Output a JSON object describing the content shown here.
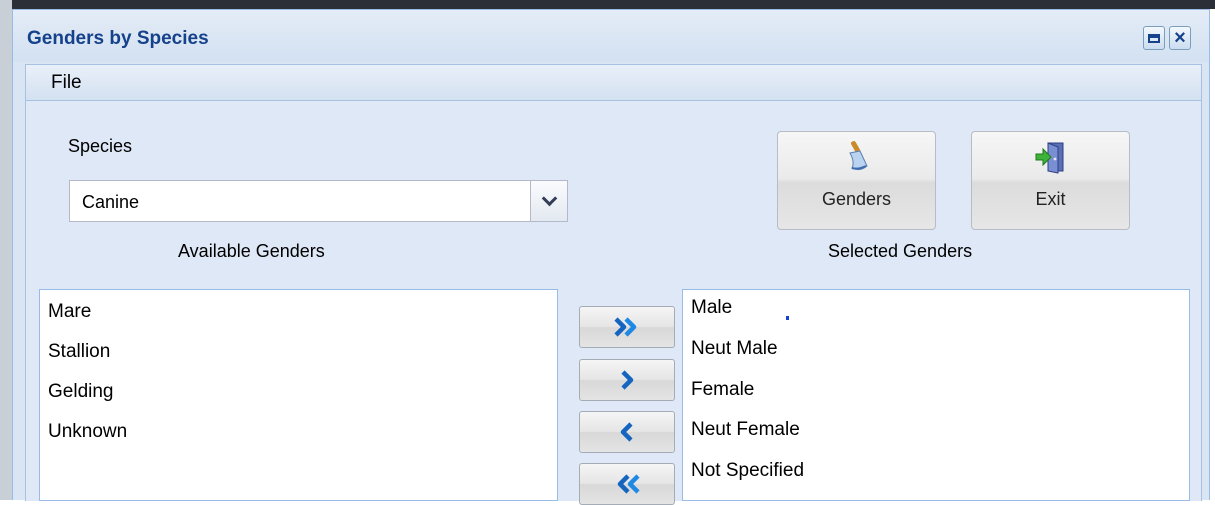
{
  "window": {
    "title": "Genders by Species",
    "menu": {
      "file": "File"
    }
  },
  "species": {
    "label": "Species",
    "selected": "Canine"
  },
  "toolbar": {
    "genders_label": "Genders",
    "exit_label": "Exit"
  },
  "available": {
    "label": "Available Genders",
    "items": [
      "Mare",
      "Stallion",
      "Gelding",
      "Unknown"
    ]
  },
  "selected": {
    "label": "Selected Genders",
    "items": [
      "Male",
      "Neut Male",
      "Female",
      "Neut Female",
      "Not Specified"
    ]
  },
  "transfer_buttons": [
    "move-all-right",
    "move-right",
    "move-left",
    "move-all-left"
  ],
  "icons": {
    "maximize": "maximize-icon",
    "close": "close-icon",
    "dropdown": "chevron-down-icon",
    "genders": "brush-icon",
    "exit": "exit-door-icon"
  },
  "colors": {
    "title_text": "#15428b",
    "panel_bg": "#dfe8f6",
    "arrow_blue": "#1565c0"
  }
}
